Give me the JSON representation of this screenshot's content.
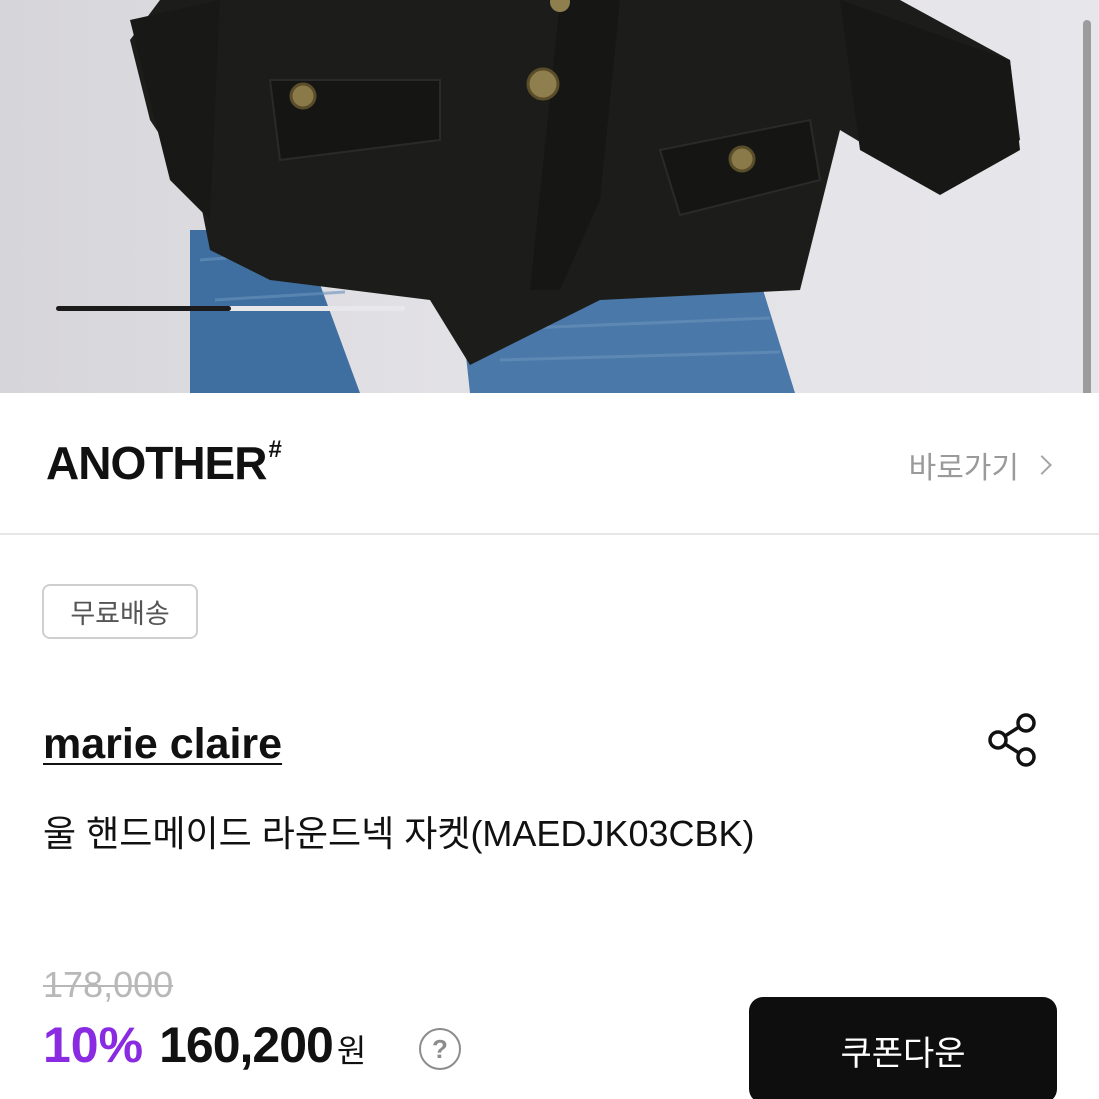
{
  "hero": {
    "image_alt": "product-photo-jacket",
    "progress": 0.5
  },
  "brand_bar": {
    "logo": "ANOTHER",
    "logo_mark": "#",
    "shortcut_label": "바로가기"
  },
  "badge": {
    "label": "무료배송"
  },
  "product": {
    "brand": "marie claire",
    "title": "울 핸드메이드 라운드넥 자켓(MAEDJK03CBK)",
    "original_price": "178,000",
    "discount": "10%",
    "price": "160,200",
    "currency": "원",
    "help_icon": "?"
  },
  "actions": {
    "coupon_label": "쿠폰다운"
  },
  "colors": {
    "accent_purple": "#8a2be2",
    "button_bg": "#0e0e0e",
    "muted_gray": "#9a9a9a"
  },
  "icons": {
    "share": "share-icon",
    "chevron": "chevron-right-icon"
  }
}
